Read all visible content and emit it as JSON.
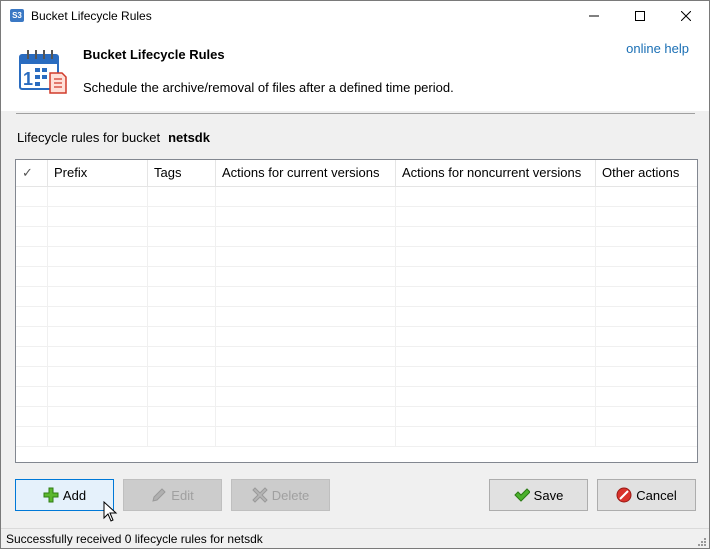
{
  "window": {
    "title": "Bucket Lifecycle Rules",
    "icon_text": "S3"
  },
  "header": {
    "title": "Bucket Lifecycle Rules",
    "description": "Schedule the archive/removal of files after a defined time period.",
    "help_link": "online help",
    "icon": "calendar-icon"
  },
  "bucket": {
    "label": "Lifecycle rules for bucket",
    "name": "netsdk"
  },
  "table": {
    "columns": [
      {
        "label": "✓"
      },
      {
        "label": "Prefix"
      },
      {
        "label": "Tags"
      },
      {
        "label": "Actions for current versions"
      },
      {
        "label": "Actions for noncurrent versions"
      },
      {
        "label": "Other actions"
      }
    ],
    "rows": []
  },
  "buttons": {
    "add": "Add",
    "edit": "Edit",
    "delete": "Delete",
    "save": "Save",
    "cancel": "Cancel"
  },
  "status": {
    "text": "Successfully received 0 lifecycle rules for netsdk"
  },
  "colors": {
    "link": "#1a6fb5",
    "focus": "#0078d7"
  }
}
